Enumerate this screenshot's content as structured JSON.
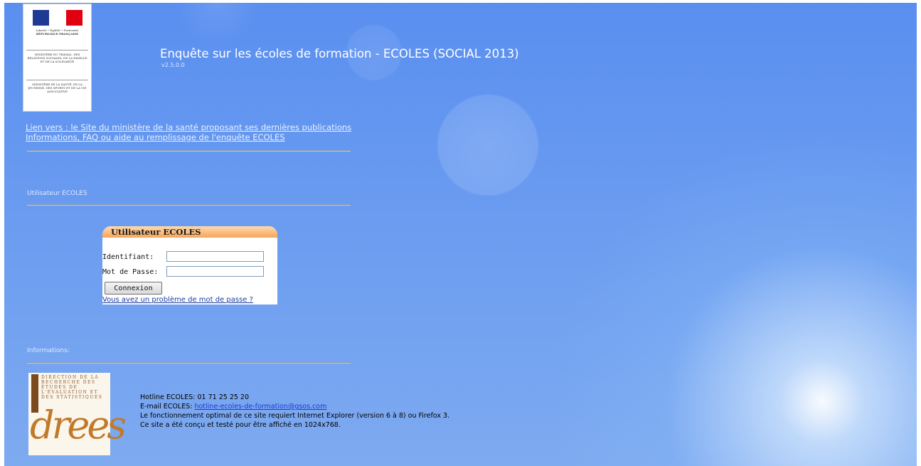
{
  "header": {
    "title": "Enquête sur les écoles de formation - ECOLES (SOCIAL 2013)",
    "version": "v2.5.0.0"
  },
  "logo_rf": {
    "motto": "Liberté • Égalité • Fraternité",
    "country": "RÉPUBLIQUE FRANÇAISE",
    "ministry1": "MINISTÈRE DU TRAVAIL, DES RELATIONS SOCIALES, DE LA FAMILLE ET DE LA SOLIDARITÉ",
    "ministry2": "MINISTÈRE DE LA SANTÉ, DE LA JEUNESSE, DES SPORTS ET DE LA VIE ASSOCIATIVE",
    "colors": {
      "blue": "#1f3a93",
      "white": "#ffffff",
      "red": "#e1000f"
    }
  },
  "links": {
    "site_link": "Lien vers : le Site du ministère de la santé proposant ses dernières publications",
    "faq_link": "Informations, FAQ ou aide au remplissage de l'enquête ECOLES"
  },
  "sections": {
    "user_label": "Utilisateur ECOLES",
    "info_label": "Informations:"
  },
  "login": {
    "header": "Utilisateur ECOLES",
    "identifiant_label": "Identifiant:",
    "identifiant_value": "",
    "password_label": "Mot de Passe:",
    "password_value": "",
    "connect_button": "Connexion",
    "forgot_link": "Vous avez un problème de mot de passe ?"
  },
  "drees_logo": {
    "text": "DIRECTION DE LA RECHERCHE DES ÉTUDES DE L'ÉVALUATION ET DES STATISTIQUES",
    "big": "drees"
  },
  "info": {
    "hotline": "Hotline ECOLES: 01 71 25 25 20",
    "email_label": "E-mail ECOLES: ",
    "email": "hotline-ecoles-de-formation@gsos.com",
    "line3": "Le fonctionnement optimal de ce site requiert Internet Explorer (version 6 à 8) ou Firefox 3.",
    "line4": "Ce site a été conçu et testé pour être affiché en 1024x768."
  }
}
